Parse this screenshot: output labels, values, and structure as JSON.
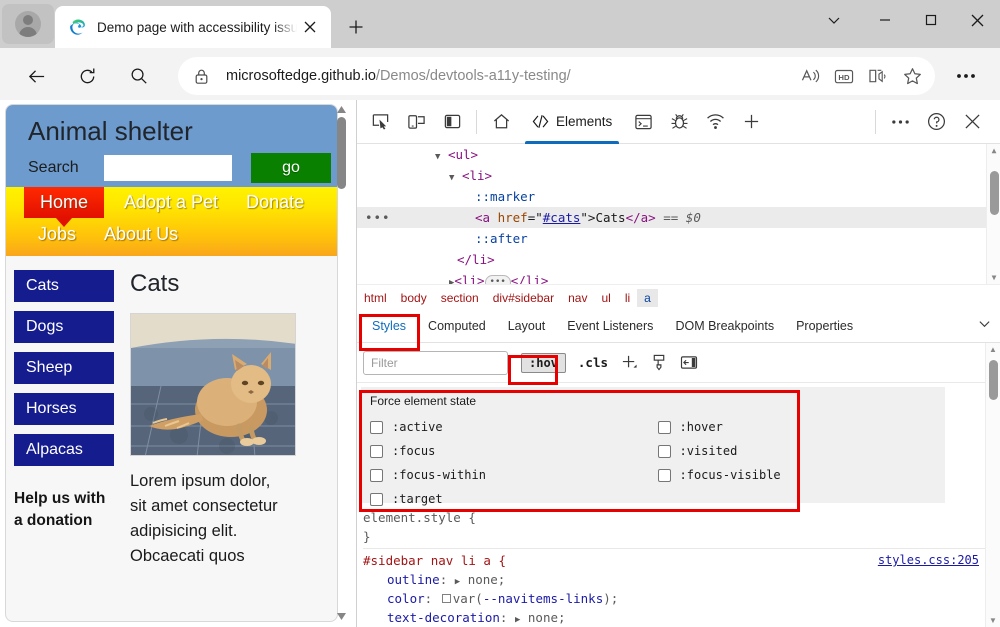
{
  "browser": {
    "tab": {
      "title": "Demo page with accessibility issu",
      "favicon_icon": "edge-logo-icon",
      "close_icon": "close-icon"
    },
    "new_tab_icon": "plus-icon",
    "profile_icon": "profile-avatar-icon",
    "window_controls": {
      "caret_icon": "chevron-down-icon",
      "minimize_icon": "minimize-icon",
      "maximize_icon": "maximize-icon",
      "close_icon": "close-icon"
    },
    "nav": {
      "back_icon": "back-arrow-icon",
      "refresh_icon": "refresh-icon",
      "search_icon": "search-icon"
    },
    "omnibox": {
      "lock_icon": "lock-icon",
      "url_host": "microsoftedge.github.io",
      "url_path": "/Demos/devtools-a11y-testing/",
      "read_aloud_icon": "read-aloud-icon",
      "hd_icon": "hd-badge-icon",
      "immersive_reader_icon": "immersive-reader-icon",
      "favorite_icon": "star-icon"
    },
    "settings_more_icon": "ellipsis-icon"
  },
  "page": {
    "site_title": "Animal shelter",
    "search_label": "Search",
    "search_value": "",
    "search_placeholder": "",
    "go_button": "go",
    "nav_row1": [
      "Home",
      "Adopt a Pet",
      "Donate"
    ],
    "nav_row2": [
      "Jobs",
      "About Us"
    ],
    "sidebar_buttons": [
      "Cats",
      "Dogs",
      "Sheep",
      "Horses",
      "Alpacas"
    ],
    "donate_blurb": "Help us with a donation",
    "main_heading": "Cats",
    "main_image_alt": "cat-photo",
    "main_paragraph": "Lorem ipsum dolor, sit amet consectetur adipisicing elit. Obcaecati quos"
  },
  "devtools": {
    "toolbar": {
      "inspect_icon": "inspect-element-icon",
      "device_emulation_icon": "device-emulation-icon",
      "dock_side_icon": "dock-side-icon",
      "home_icon": "home-icon",
      "elements_tab": "Elements",
      "elements_icon": "code-brackets-icon",
      "console_icon": "console-icon",
      "sources_icon": "debug-bug-icon",
      "network_icon": "network-wifi-icon",
      "add_tool_icon": "plus-icon",
      "more_tools_icon": "ellipsis-icon",
      "help_icon": "question-circle-icon",
      "close_icon": "close-icon"
    },
    "dom_lines": [
      {
        "indent": 2,
        "tri": "down",
        "text": "<ul>",
        "kind": "tag"
      },
      {
        "indent": 3,
        "tri": "down",
        "text": "<li>",
        "kind": "tag"
      },
      {
        "indent": 4,
        "tri": "",
        "text": "::marker",
        "kind": "pseudo"
      },
      {
        "indent": 4,
        "tri": "",
        "text": "<a href=\"#cats\">Cats</a> == $0",
        "kind": "selected"
      },
      {
        "indent": 4,
        "tri": "",
        "text": "::after",
        "kind": "pseudo"
      },
      {
        "indent": 3,
        "tri": "",
        "text": "</li>",
        "kind": "tag"
      },
      {
        "indent": 3,
        "tri": "right",
        "text": "<li>…</li>",
        "kind": "tag"
      }
    ],
    "selected_node": {
      "tag_open": "<a",
      "attr_name": "href",
      "attr_value": "#cats",
      "inner_text": "Cats",
      "tag_close": "</a>",
      "console_ref": "== $0"
    },
    "breadcrumb": [
      "html",
      "body",
      "section",
      "div#sidebar",
      "nav",
      "ul",
      "li",
      "a"
    ],
    "breadcrumb_active": "a",
    "pane_tabs": [
      "Styles",
      "Computed",
      "Layout",
      "Event Listeners",
      "DOM Breakpoints",
      "Properties"
    ],
    "pane_tab_selected": "Styles",
    "pane_tabs_overflow_icon": "chevron-down-icon",
    "styles_toolbar": {
      "filter_placeholder": "Filter",
      "filter_value": "",
      "hov_button": ":hov",
      "cls_button": ".cls",
      "new_rule_icon": "plus-icon",
      "print_media_icon": "print-preview-icon",
      "computed_sidebar_icon": "toggle-sidebar-icon"
    },
    "force_element_state": {
      "title": "Force element state",
      "left_column": [
        {
          "label": ":active",
          "checked": false
        },
        {
          "label": ":focus",
          "checked": false
        },
        {
          "label": ":focus-within",
          "checked": false
        },
        {
          "label": ":target",
          "checked": false
        }
      ],
      "right_column": [
        {
          "label": ":hover",
          "checked": false
        },
        {
          "label": ":visited",
          "checked": false
        },
        {
          "label": ":focus-visible",
          "checked": false
        }
      ]
    },
    "css_rules": [
      {
        "selector": "element.style {",
        "source": "",
        "declarations": [],
        "close": "}"
      },
      {
        "selector": "#sidebar nav li a {",
        "source": "styles.css:205",
        "declarations": [
          {
            "property": "outline",
            "value": "none;",
            "has_arrow": true,
            "has_swatch": false
          },
          {
            "property": "color",
            "value": "var(--navitems-links);",
            "has_arrow": false,
            "has_swatch": true
          },
          {
            "property": "text-decoration",
            "value": "none;",
            "has_arrow": true,
            "has_swatch": false
          }
        ],
        "close": ""
      }
    ]
  },
  "annotations": {
    "highlight_color": "#e60000",
    "boxes": [
      "styles-tab",
      "hov-button",
      "force-element-state-panel"
    ]
  }
}
